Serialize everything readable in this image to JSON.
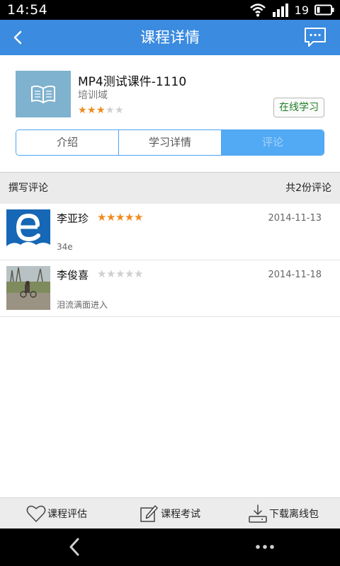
{
  "status_bar": {
    "time": "14:54",
    "battery_level": "19"
  },
  "header": {
    "title": "课程详情"
  },
  "course": {
    "title": "MP4测试课件-1110",
    "category": "培训域",
    "rating": 3,
    "rating_max": 5,
    "learn_button": "在线学习"
  },
  "tabs": [
    {
      "label": "介绍",
      "active": false
    },
    {
      "label": "学习详情",
      "active": false
    },
    {
      "label": "评论",
      "active": true
    }
  ],
  "comments_bar": {
    "write_label": "撰写评论",
    "count_label": "共2份评论"
  },
  "comments": [
    {
      "name": "李亚珍",
      "rating": 5,
      "date": "2014-11-13",
      "text": "34e"
    },
    {
      "name": "李俊喜",
      "rating": 0,
      "date": "2014-11-18",
      "text": "泪流满面进入"
    }
  ],
  "toolbar": {
    "evaluate": "课程评估",
    "exam": "课程考试",
    "download": "下载离线包"
  },
  "colors": {
    "header": "#3b8be0",
    "accent_star": "#f08a1c",
    "learn_text": "#1e7d24",
    "active_tab": "#53aaf4"
  },
  "icons": {
    "status": [
      "wifi-icon",
      "signal-icon",
      "battery-icon"
    ],
    "header": [
      "back-arrow-icon",
      "chat-bubble-icon"
    ],
    "toolbar": [
      "heart-icon",
      "edit-pencil-icon",
      "download-icon"
    ],
    "nav": [
      "nav-back-icon",
      "nav-more-icon"
    ]
  }
}
